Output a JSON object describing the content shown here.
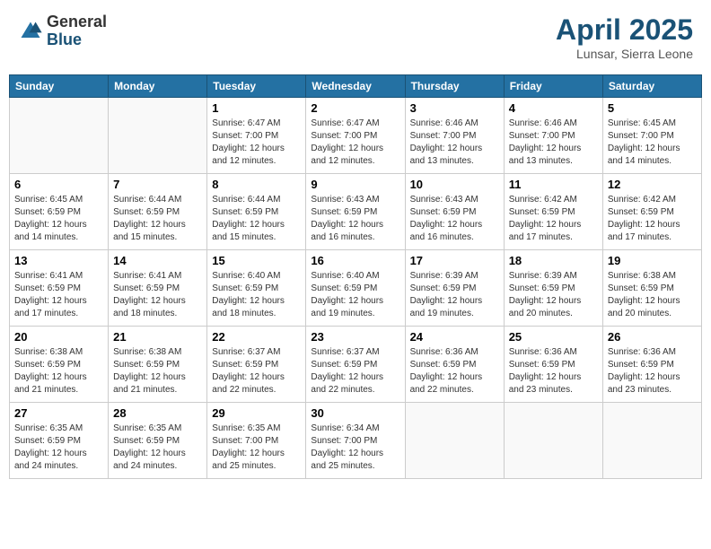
{
  "header": {
    "logo_general": "General",
    "logo_blue": "Blue",
    "month_title": "April 2025",
    "location": "Lunsar, Sierra Leone"
  },
  "days_of_week": [
    "Sunday",
    "Monday",
    "Tuesday",
    "Wednesday",
    "Thursday",
    "Friday",
    "Saturday"
  ],
  "weeks": [
    [
      {
        "day": "",
        "info": ""
      },
      {
        "day": "",
        "info": ""
      },
      {
        "day": "1",
        "info": "Sunrise: 6:47 AM\nSunset: 7:00 PM\nDaylight: 12 hours and 12 minutes."
      },
      {
        "day": "2",
        "info": "Sunrise: 6:47 AM\nSunset: 7:00 PM\nDaylight: 12 hours and 12 minutes."
      },
      {
        "day": "3",
        "info": "Sunrise: 6:46 AM\nSunset: 7:00 PM\nDaylight: 12 hours and 13 minutes."
      },
      {
        "day": "4",
        "info": "Sunrise: 6:46 AM\nSunset: 7:00 PM\nDaylight: 12 hours and 13 minutes."
      },
      {
        "day": "5",
        "info": "Sunrise: 6:45 AM\nSunset: 7:00 PM\nDaylight: 12 hours and 14 minutes."
      }
    ],
    [
      {
        "day": "6",
        "info": "Sunrise: 6:45 AM\nSunset: 6:59 PM\nDaylight: 12 hours and 14 minutes."
      },
      {
        "day": "7",
        "info": "Sunrise: 6:44 AM\nSunset: 6:59 PM\nDaylight: 12 hours and 15 minutes."
      },
      {
        "day": "8",
        "info": "Sunrise: 6:44 AM\nSunset: 6:59 PM\nDaylight: 12 hours and 15 minutes."
      },
      {
        "day": "9",
        "info": "Sunrise: 6:43 AM\nSunset: 6:59 PM\nDaylight: 12 hours and 16 minutes."
      },
      {
        "day": "10",
        "info": "Sunrise: 6:43 AM\nSunset: 6:59 PM\nDaylight: 12 hours and 16 minutes."
      },
      {
        "day": "11",
        "info": "Sunrise: 6:42 AM\nSunset: 6:59 PM\nDaylight: 12 hours and 17 minutes."
      },
      {
        "day": "12",
        "info": "Sunrise: 6:42 AM\nSunset: 6:59 PM\nDaylight: 12 hours and 17 minutes."
      }
    ],
    [
      {
        "day": "13",
        "info": "Sunrise: 6:41 AM\nSunset: 6:59 PM\nDaylight: 12 hours and 17 minutes."
      },
      {
        "day": "14",
        "info": "Sunrise: 6:41 AM\nSunset: 6:59 PM\nDaylight: 12 hours and 18 minutes."
      },
      {
        "day": "15",
        "info": "Sunrise: 6:40 AM\nSunset: 6:59 PM\nDaylight: 12 hours and 18 minutes."
      },
      {
        "day": "16",
        "info": "Sunrise: 6:40 AM\nSunset: 6:59 PM\nDaylight: 12 hours and 19 minutes."
      },
      {
        "day": "17",
        "info": "Sunrise: 6:39 AM\nSunset: 6:59 PM\nDaylight: 12 hours and 19 minutes."
      },
      {
        "day": "18",
        "info": "Sunrise: 6:39 AM\nSunset: 6:59 PM\nDaylight: 12 hours and 20 minutes."
      },
      {
        "day": "19",
        "info": "Sunrise: 6:38 AM\nSunset: 6:59 PM\nDaylight: 12 hours and 20 minutes."
      }
    ],
    [
      {
        "day": "20",
        "info": "Sunrise: 6:38 AM\nSunset: 6:59 PM\nDaylight: 12 hours and 21 minutes."
      },
      {
        "day": "21",
        "info": "Sunrise: 6:38 AM\nSunset: 6:59 PM\nDaylight: 12 hours and 21 minutes."
      },
      {
        "day": "22",
        "info": "Sunrise: 6:37 AM\nSunset: 6:59 PM\nDaylight: 12 hours and 22 minutes."
      },
      {
        "day": "23",
        "info": "Sunrise: 6:37 AM\nSunset: 6:59 PM\nDaylight: 12 hours and 22 minutes."
      },
      {
        "day": "24",
        "info": "Sunrise: 6:36 AM\nSunset: 6:59 PM\nDaylight: 12 hours and 22 minutes."
      },
      {
        "day": "25",
        "info": "Sunrise: 6:36 AM\nSunset: 6:59 PM\nDaylight: 12 hours and 23 minutes."
      },
      {
        "day": "26",
        "info": "Sunrise: 6:36 AM\nSunset: 6:59 PM\nDaylight: 12 hours and 23 minutes."
      }
    ],
    [
      {
        "day": "27",
        "info": "Sunrise: 6:35 AM\nSunset: 6:59 PM\nDaylight: 12 hours and 24 minutes."
      },
      {
        "day": "28",
        "info": "Sunrise: 6:35 AM\nSunset: 6:59 PM\nDaylight: 12 hours and 24 minutes."
      },
      {
        "day": "29",
        "info": "Sunrise: 6:35 AM\nSunset: 7:00 PM\nDaylight: 12 hours and 25 minutes."
      },
      {
        "day": "30",
        "info": "Sunrise: 6:34 AM\nSunset: 7:00 PM\nDaylight: 12 hours and 25 minutes."
      },
      {
        "day": "",
        "info": ""
      },
      {
        "day": "",
        "info": ""
      },
      {
        "day": "",
        "info": ""
      }
    ]
  ]
}
